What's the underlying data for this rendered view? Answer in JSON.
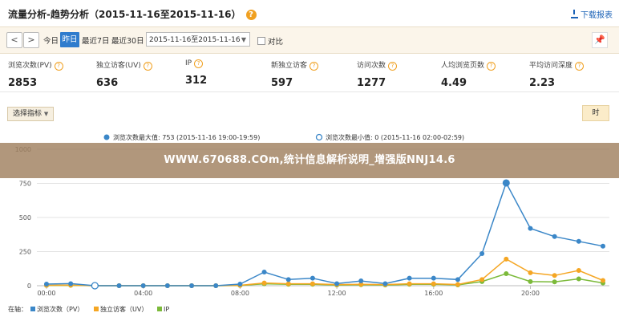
{
  "header": {
    "title": "流量分析-趋势分析（2015-11-16至2015-11-16）",
    "help_glyph": "?",
    "download_label": "下载报表"
  },
  "toolbar": {
    "prev_glyph": "<",
    "next_glyph": ">",
    "today": "今日",
    "yesterday": "昨日",
    "last7": "最近7日",
    "last30": "最近30日",
    "date_range": "2015-11-16至2015-11-16",
    "compare_label": "对比",
    "pin_glyph": "📌"
  },
  "metrics": [
    {
      "label": "浏览次数(PV)",
      "value": "2853"
    },
    {
      "label": "独立访客(UV)",
      "value": "636"
    },
    {
      "label": "IP",
      "value": "312"
    },
    {
      "label": "新独立访客",
      "value": "597"
    },
    {
      "label": "访问次数",
      "value": "1277"
    },
    {
      "label": "人均浏览页数",
      "value": "4.49"
    },
    {
      "label": "平均访问深度",
      "value": "2.23"
    }
  ],
  "controls": {
    "select_metric": "选择指标",
    "hour_button": "时"
  },
  "legend_top": {
    "max_label": "浏览次数最大值: 753 (2015-11-16 19:00-19:59)",
    "min_label": "浏览次数最小值: 0 (2015-11-16 02:00-02:59)"
  },
  "banner": "WWW.670688.COm,统计信息解析说明_增强版NNJ14.6",
  "legend_bottom": {
    "prefix": "在轴：",
    "items": [
      "浏览次数（PV）",
      "独立访客（UV）",
      "IP"
    ]
  },
  "colors": {
    "pv": "#3b87c8",
    "uv": "#f5a623",
    "ip": "#7cba3a"
  },
  "chart_data": {
    "type": "line",
    "x": [
      "00:00",
      "01:00",
      "02:00",
      "03:00",
      "04:00",
      "05:00",
      "06:00",
      "07:00",
      "08:00",
      "09:00",
      "10:00",
      "11:00",
      "12:00",
      "13:00",
      "14:00",
      "15:00",
      "16:00",
      "17:00",
      "18:00",
      "19:00",
      "20:00",
      "21:00",
      "22:00",
      "23:00"
    ],
    "xticks": [
      "00:00",
      "04:00",
      "08:00",
      "12:00",
      "16:00",
      "20:00"
    ],
    "yticks": [
      "0",
      "250",
      "500",
      "750",
      "1000"
    ],
    "ylim": [
      0,
      1000
    ],
    "series": [
      {
        "name": "浏览次数（PV）",
        "values": [
          12,
          15,
          0,
          0,
          0,
          0,
          0,
          0,
          12,
          100,
          45,
          55,
          15,
          35,
          15,
          55,
          55,
          45,
          235,
          753,
          420,
          360,
          325,
          290
        ]
      },
      {
        "name": "独立访客（UV）",
        "values": [
          3,
          4,
          0,
          0,
          0,
          0,
          0,
          0,
          3,
          20,
          14,
          14,
          8,
          10,
          8,
          14,
          14,
          9,
          45,
          195,
          95,
          75,
          112,
          38
        ]
      },
      {
        "name": "IP",
        "values": [
          2,
          3,
          0,
          0,
          0,
          0,
          0,
          0,
          2,
          14,
          10,
          10,
          5,
          7,
          5,
          10,
          10,
          6,
          30,
          88,
          30,
          28,
          50,
          20
        ]
      }
    ]
  }
}
